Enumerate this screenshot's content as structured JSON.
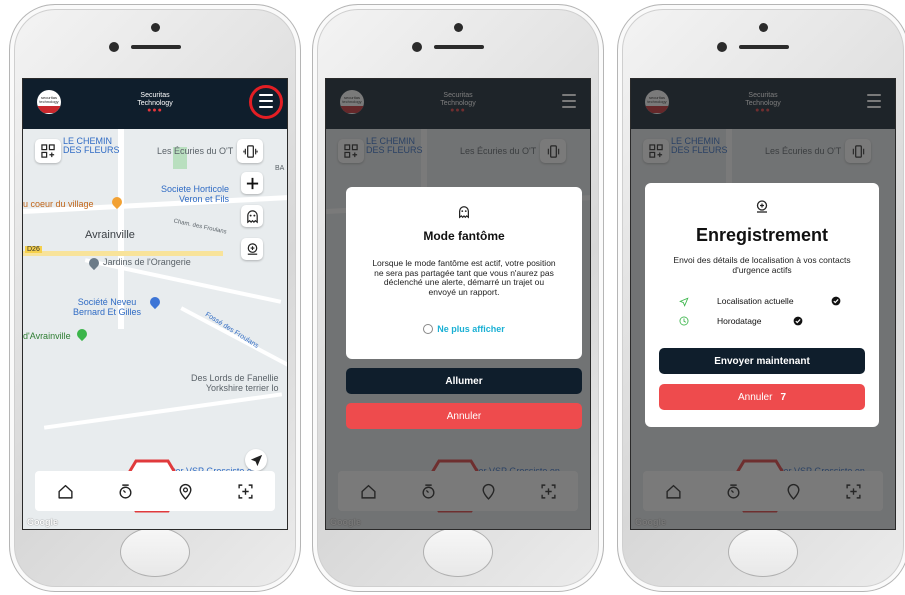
{
  "header": {
    "brand_line1": "Securitas",
    "brand_line2": "Technology",
    "brand_dots": "●●●",
    "logo_text": "securitas technology"
  },
  "map": {
    "labels": {
      "chemin": "LE CHEMIN\nDES FLEURS",
      "ecuries": "Les Écuries du O'T",
      "horticole": "Societe Horticole\nVeron et Fils",
      "village": "u coeur du village",
      "cham": "Cham. des Froulans",
      "avrainville": "Avrainville",
      "road_num": "D26",
      "jardins": "Jardins de l'Orangerie",
      "neveu": "Société Neveu\nBernard Et Gilles",
      "fosse": "Fossé des Froulans",
      "davrainville": "d'Avrainville",
      "lords": "Des Lords de Fanellie\nYorkshire terrier lo",
      "mister": "Mister VSP Grossiste en",
      "google": "Google",
      "ba": "BA",
      "che": "Che"
    }
  },
  "screen2": {
    "modal_title": "Mode fantôme",
    "modal_body": "Lorsque le mode fantôme est actif, votre position ne sera pas partagée tant que vous n'aurez pas déclenché une alerte, démarré un trajet ou envoyé un rapport.",
    "checkbox_label": "Ne plus afficher",
    "primary_button": "Allumer",
    "secondary_button": "Annuler"
  },
  "screen3": {
    "modal_title": "Enregistrement",
    "modal_body": "Envoi des détails de localisation à vos contacts d'urgence actifs",
    "items": [
      {
        "label": "Localisation actuelle"
      },
      {
        "label": "Horodatage"
      }
    ],
    "primary_button": "Envoyer maintenant",
    "secondary_button": "Annuler",
    "countdown": "7"
  },
  "colors": {
    "navy": "#0f1e2c",
    "red": "#e31e24",
    "button_red": "#ee4b4d",
    "link_cyan": "#1ab0d4",
    "green": "#3bb54a"
  }
}
